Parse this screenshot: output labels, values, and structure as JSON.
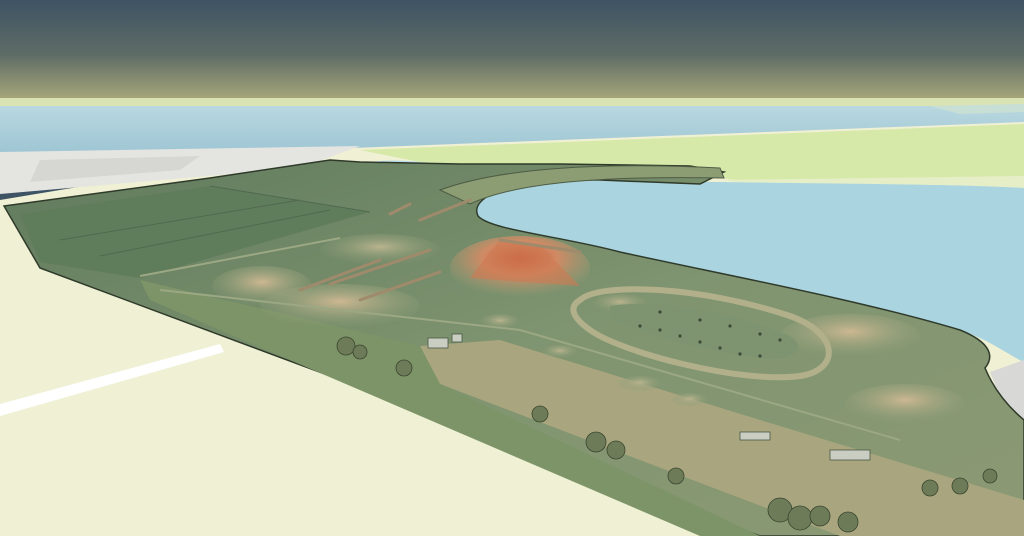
{
  "scene": {
    "kind": "3d-terrain-view",
    "subject": "quarry-site-elevation-model",
    "colors": {
      "sky_top": "#3e5364",
      "sky_horizon": "#a7a87a",
      "basemap_land": "#eff0d4",
      "basemap_green": "#d6e9a8",
      "water": "#a9d4e0",
      "sea": "#9fc8d6",
      "terrain_low": "#6b8565",
      "terrain_mid": "#8fa07a",
      "terrain_high": "#c9a07a",
      "terrain_peak": "#c75a3a",
      "road": "#ffffff",
      "urban": "#e2e2e2"
    }
  }
}
